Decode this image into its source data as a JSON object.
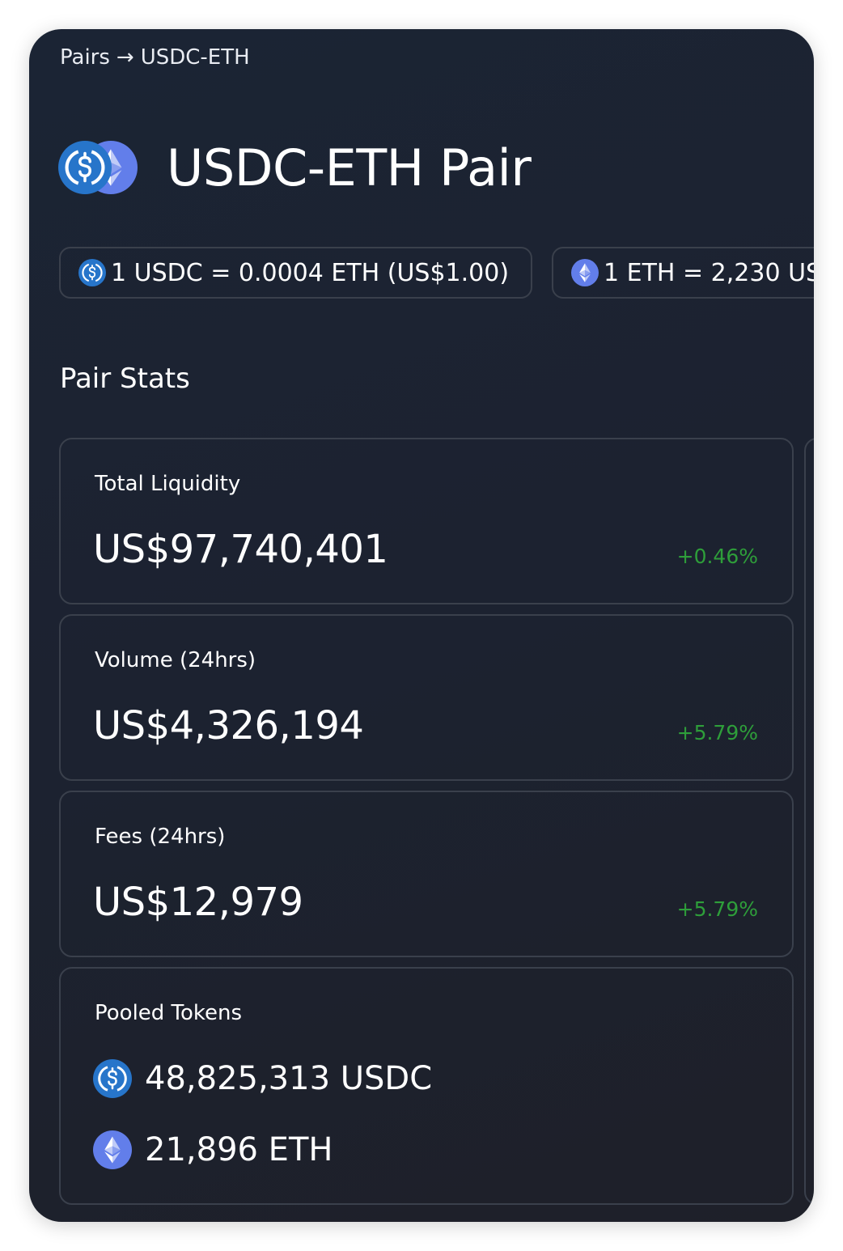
{
  "breadcrumb": {
    "root": "Pairs",
    "separator": "→",
    "current": "USDC-ETH"
  },
  "header": {
    "title": "USDC-ETH Pair",
    "token_icons": [
      "usdc-icon",
      "eth-icon"
    ]
  },
  "rates": [
    {
      "icon": "usdc-icon",
      "text": "1 USDC = 0.0004 ETH (US$1.00)"
    },
    {
      "icon": "eth-icon",
      "text": "1 ETH = 2,230 US"
    }
  ],
  "pair_stats": {
    "title": "Pair Stats",
    "total_liquidity": {
      "label": "Total Liquidity",
      "value": "US$97,740,401",
      "change": "+0.46%"
    },
    "volume": {
      "label": "Volume (24hrs)",
      "value": "US$4,326,194",
      "change": "+5.79%"
    },
    "fees": {
      "label": "Fees (24hrs)",
      "value": "US$12,979",
      "change": "+5.79%"
    },
    "pooled_tokens": {
      "label": "Pooled Tokens",
      "tokens": [
        {
          "icon": "usdc-icon",
          "text": "48,825,313 USDC"
        },
        {
          "icon": "eth-icon",
          "text": "21,896 ETH"
        }
      ]
    }
  },
  "colors": {
    "background": "#1c2230",
    "border": "#3a404c",
    "positive": "#2e9e3a",
    "usdc_blue": "#2775ca",
    "eth_purple": "#627eea"
  }
}
